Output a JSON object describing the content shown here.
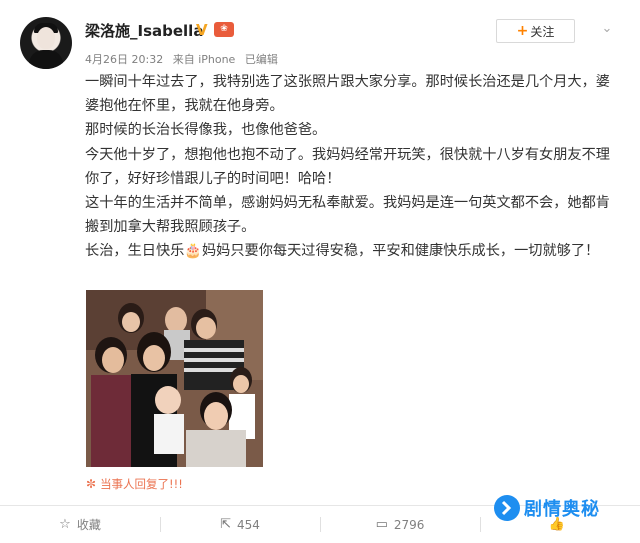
{
  "user": {
    "name": "梁洛施_Isabella",
    "time": "4月26日 20:32",
    "source": "来自 iPhone",
    "edited": "已编辑"
  },
  "header": {
    "follow_label": "关注",
    "follow_plus": "+",
    "verified_glyph": "V",
    "vip_glyph": "❀"
  },
  "content": {
    "paragraphs": [
      "一瞬间十年过去了，我特别选了这张照片跟大家分享。那时候长治还是几个月大，婆婆抱他在怀里，我就在他身旁。",
      "那时候的长治长得像我，也像他爸爸。",
      "今天他十岁了，想抱他也抱不动了。我妈妈经常开玩笑，很快就十八岁有女朋友不理你了，好好珍惜跟儿子的时间吧！哈哈！",
      "这十年的生活并不简单，感谢妈妈无私奉献爱。我妈妈是连一句英文都不会，她都肯搬到加拿大帮我照顾孩子。",
      "长治，生日快乐🎂妈妈只要你每天过得安稳，平安和健康快乐成长，一切就够了！"
    ]
  },
  "reply_note": {
    "icon": "✼",
    "text": "当事人回复了!!!"
  },
  "actions": [
    {
      "icon": "☆",
      "label": "收藏"
    },
    {
      "icon": "⇱",
      "label": "454"
    },
    {
      "icon": "▭",
      "label": "2796"
    },
    {
      "icon": "👍",
      "label": ""
    }
  ],
  "watermark": {
    "text": "剧情奥秘"
  },
  "colors": {
    "accent": "#ff8200",
    "reply": "#eb7350",
    "watermark": "#1e8ef0"
  }
}
